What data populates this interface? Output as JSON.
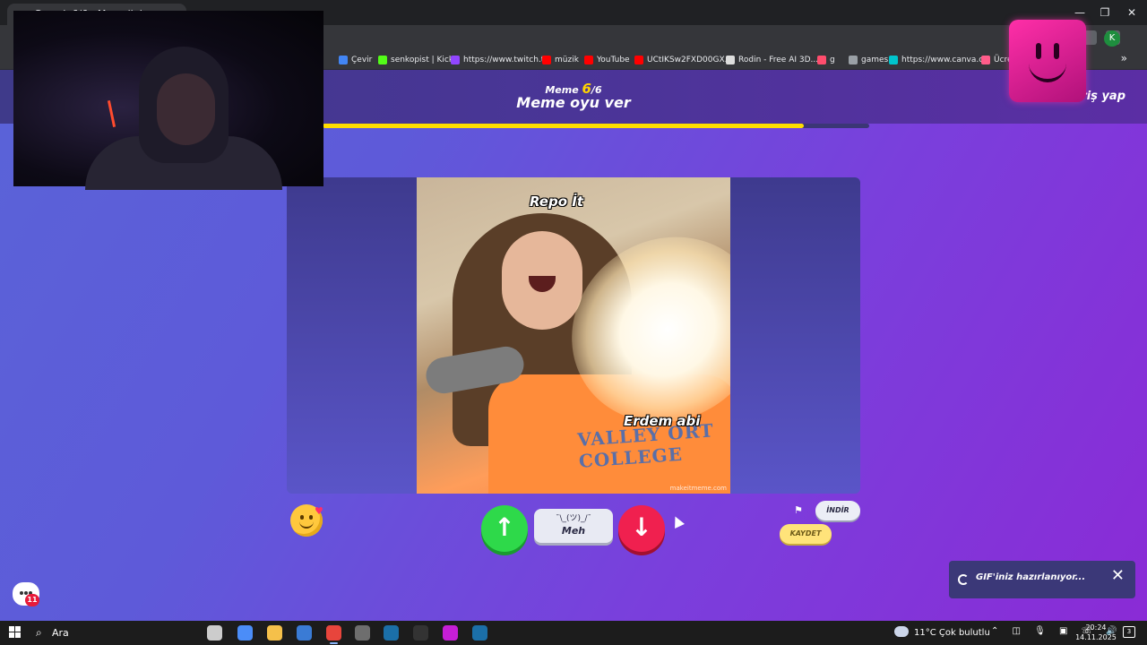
{
  "browser": {
    "tab_title": "Gerçek 6/6 - Meme'ini oy ver",
    "bookmarks": [
      {
        "label": "...",
        "color": "#8ab4f8"
      },
      {
        "label": "Çevir",
        "color": "#4285f4"
      },
      {
        "label": "senkopist | Kick",
        "color": "#53fc18"
      },
      {
        "label": "https://www.twitch.t...",
        "color": "#9146ff"
      },
      {
        "label": "müzik",
        "color": "#ff0000"
      },
      {
        "label": "YouTube",
        "color": "#ff0000"
      },
      {
        "label": "UCtIKSw2FXD00GX...",
        "color": "#ff0000"
      },
      {
        "label": "Rodin - Free AI 3D...",
        "color": "#dddddd"
      },
      {
        "label": "g",
        "color": "#ff4d6d"
      },
      {
        "label": "games",
        "color": "#9aa0a6"
      },
      {
        "label": "https://www.canva.c...",
        "color": "#00c4cc"
      },
      {
        "label": "Ücre",
        "color": "#ff5c8a"
      }
    ],
    "more_bookmarks": "»",
    "profile_initial": "K",
    "window_controls": {
      "minimize": "—",
      "maximize": "❐",
      "close": "✕"
    }
  },
  "page": {
    "counter_label": "Meme",
    "counter_current": "6",
    "counter_total": "/6",
    "title": "Meme oyu ver",
    "login": "Giriş yap",
    "progress": 0.88,
    "meme": {
      "caption_top": "Repo İt",
      "caption_bottom": "Erdem abi",
      "shirt_text": "VALLEY ORT COLLEGE",
      "watermark": "makeitmeme.com"
    },
    "actions": {
      "upvote": "↑",
      "meh_face": "¯\\_(ツ)_/¯",
      "meh_label": "Meh",
      "downvote": "↓",
      "flag": "⚑",
      "download": "İNDİR",
      "save": "KAYDET"
    },
    "toast": {
      "text": "GIF'iniz hazırlanıyor...",
      "close": "✕"
    },
    "chat_badge": "11"
  },
  "taskbar": {
    "search_label": "Ara",
    "weather": "11°C  Çok bulutlu",
    "tray": "⌃ ◫ 🎙 ▣ ☏ 🔊",
    "time": "20:24",
    "date": "14.11.2025",
    "notifications": "3",
    "apps": [
      {
        "name": "taskview",
        "color": "#cccccc"
      },
      {
        "name": "copilot",
        "color": "#4b8df8"
      },
      {
        "name": "file-explorer",
        "color": "#f5c04a"
      },
      {
        "name": "store",
        "color": "#3a7bd5"
      },
      {
        "name": "chrome",
        "color": "#e8453c"
      },
      {
        "name": "obs",
        "color": "#6e6e6e"
      },
      {
        "name": "steam",
        "color": "#1b6fa8"
      },
      {
        "name": "epic-games",
        "color": "#333333"
      },
      {
        "name": "kick-app",
        "color": "#c61ed6"
      },
      {
        "name": "steam-2",
        "color": "#1b6fa8"
      }
    ]
  },
  "colors": {
    "accent_yellow": "#ffde00",
    "upvote_green": "#2ed94a",
    "downvote_red": "#f0204f",
    "background_start": "#5a63d8",
    "background_end": "#8a2bd6"
  }
}
